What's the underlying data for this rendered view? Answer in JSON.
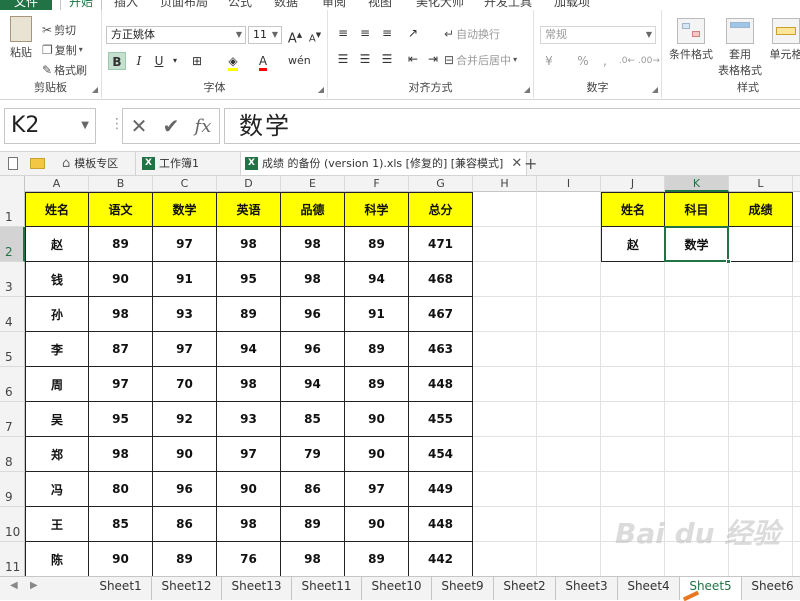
{
  "ribbon_tabs": [
    "文件",
    "开始",
    "插入",
    "页面布局",
    "公式",
    "数据",
    "审阅",
    "视图",
    "美化大师",
    "开发工具",
    "加载项"
  ],
  "ribbon": {
    "clipboard": {
      "paste": "粘贴",
      "cut": "剪切",
      "copy": "复制",
      "format_painter": "格式刷",
      "label": "剪贴板"
    },
    "font": {
      "name": "方正姚体",
      "size": "11",
      "label": "字体",
      "bold": "B",
      "italic": "I",
      "underline": "U",
      "grow": "A",
      "shrink": "A"
    },
    "alignment": {
      "wrap": "自动换行",
      "merge": "合并后居中",
      "label": "对齐方式"
    },
    "number": {
      "format": "常规",
      "label": "数字",
      "percent": "%",
      "comma": ","
    },
    "styles": {
      "conditional": "条件格式",
      "table_line1": "套用",
      "table_line2": "表格格式",
      "cell_styles": "单元格",
      "label": "样式"
    },
    "colors": {
      "excel_green": "#217346",
      "highlight": "#ffff00",
      "font_red": "#ff0000"
    }
  },
  "formula_bar": {
    "name_box": "K2",
    "content": "数学",
    "fx": "fx"
  },
  "doc_tabs": [
    {
      "label": "模板专区"
    },
    {
      "label": "工作簿1"
    },
    {
      "label": "成绩 的备份 (version 1).xls [修复的]  [兼容模式]"
    }
  ],
  "columns": [
    "A",
    "B",
    "C",
    "D",
    "E",
    "F",
    "G",
    "H",
    "I",
    "J",
    "K",
    "L"
  ],
  "rows": [
    "1",
    "2",
    "3",
    "4",
    "5",
    "6",
    "7",
    "8",
    "9",
    "10",
    "11"
  ],
  "table": {
    "headers": [
      "姓名",
      "语文",
      "数学",
      "英语",
      "品德",
      "科学",
      "总分"
    ],
    "rows": [
      [
        "赵",
        "89",
        "97",
        "98",
        "98",
        "89",
        "471"
      ],
      [
        "钱",
        "90",
        "91",
        "95",
        "98",
        "94",
        "468"
      ],
      [
        "孙",
        "98",
        "93",
        "89",
        "96",
        "91",
        "467"
      ],
      [
        "李",
        "87",
        "97",
        "94",
        "96",
        "89",
        "463"
      ],
      [
        "周",
        "97",
        "70",
        "98",
        "94",
        "89",
        "448"
      ],
      [
        "吴",
        "95",
        "92",
        "93",
        "85",
        "90",
        "455"
      ],
      [
        "郑",
        "98",
        "90",
        "97",
        "79",
        "90",
        "454"
      ],
      [
        "冯",
        "80",
        "96",
        "90",
        "86",
        "97",
        "449"
      ],
      [
        "王",
        "85",
        "86",
        "98",
        "89",
        "90",
        "448"
      ],
      [
        "陈",
        "90",
        "89",
        "76",
        "98",
        "89",
        "442"
      ]
    ]
  },
  "lookup": {
    "headers": [
      "姓名",
      "科目",
      "成绩"
    ],
    "row": [
      "赵",
      "数学",
      ""
    ]
  },
  "sheet_tabs": [
    "Sheet1",
    "Sheet12",
    "Sheet13",
    "Sheet11",
    "Sheet10",
    "Sheet9",
    "Sheet2",
    "Sheet3",
    "Sheet4",
    "Sheet5",
    "Sheet6"
  ],
  "active_sheet": "Sheet5",
  "watermark": "Bai du 经验"
}
